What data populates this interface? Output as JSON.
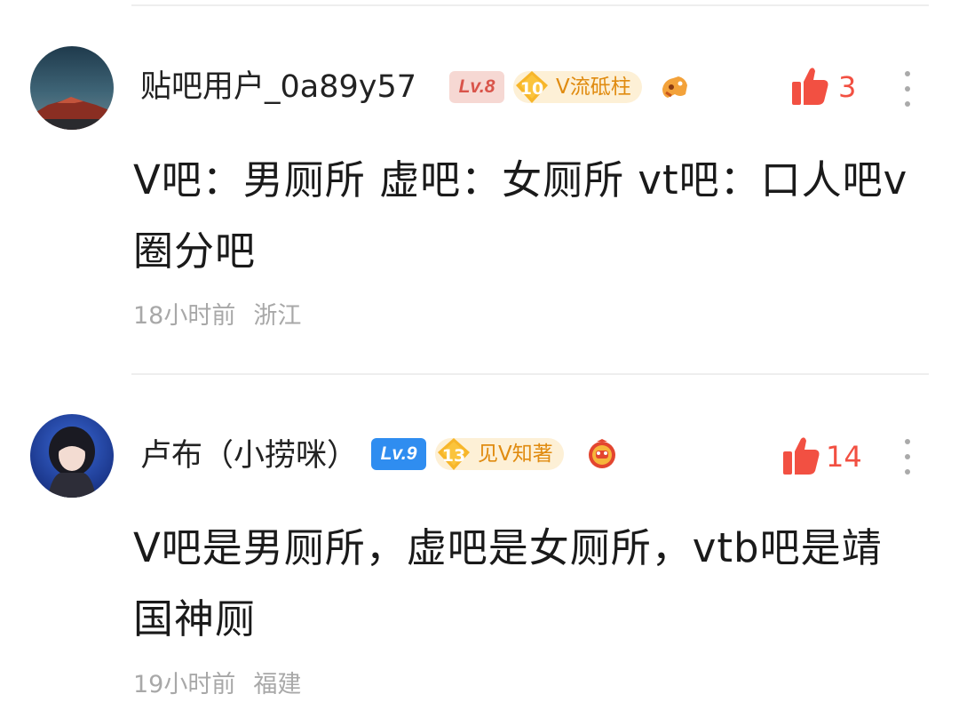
{
  "comments": [
    {
      "username": "贴吧用户_0a89y57",
      "level": "Lv.8",
      "level_color": "#f3d4d0",
      "level_text_color": "#d9544a",
      "tag_level": "10",
      "tag_label": "V流砥柱",
      "like_count": "3",
      "content": "V吧：男厕所 虚吧：女厕所 vt吧：口人吧v圈分吧",
      "time": "18小时前",
      "location": "浙江",
      "avatar_icon": "mountain-sunset-avatar",
      "emblem_icon": "controller-emblem-icon"
    },
    {
      "username": "卢布（小捞咪）",
      "level": "Lv.9",
      "level_color": "#2f8df0",
      "level_text_color": "#ffffff",
      "tag_level": "13",
      "tag_label": "见V知著",
      "like_count": "14",
      "content": "V吧是男厕所，虚吧是女厕所，vtb吧是靖国神厕",
      "time": "19小时前",
      "location": "福建",
      "avatar_icon": "anime-girl-avatar",
      "emblem_icon": "lion-emblem-icon"
    }
  ],
  "colors": {
    "like": "#f25042",
    "tag_bg": "#fdf0d6",
    "tag_text": "#e08b10",
    "meta": "#a8a8a8"
  }
}
